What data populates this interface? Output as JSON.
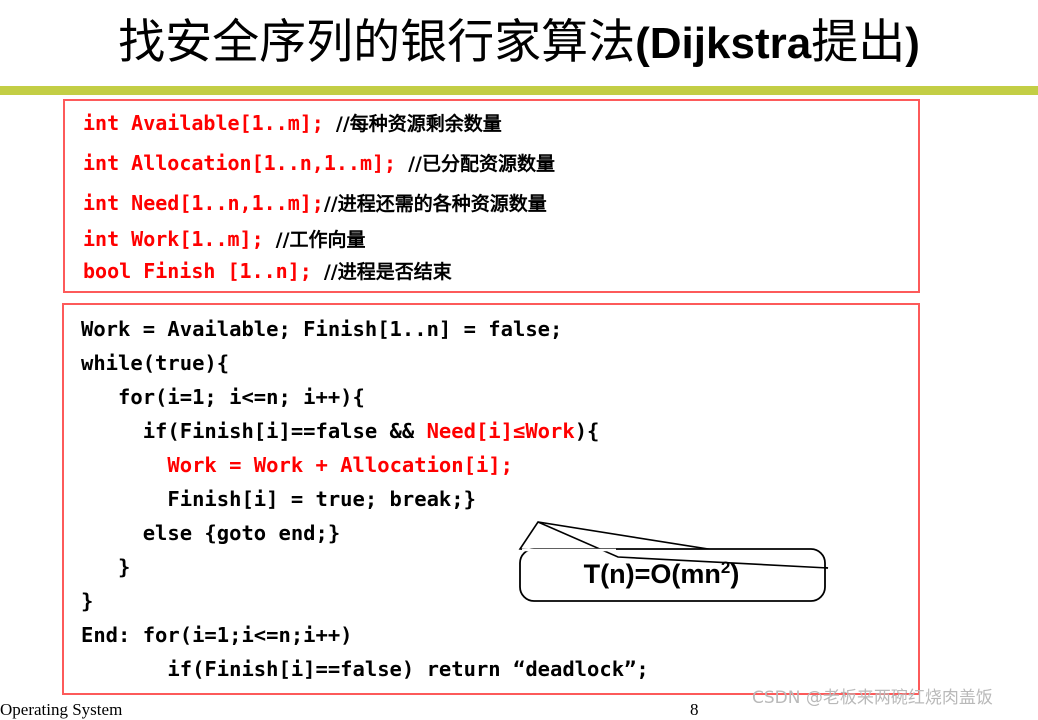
{
  "slide": {
    "title_cn_before": "找安全序列的银行家算法",
    "title_paren_open": "(",
    "title_latin": "Dijkstra",
    "title_cn_after": "提出",
    "title_paren_close": ")",
    "divider_color": "#c3ce45",
    "code_accent_color": "#ff0000",
    "box_border_color": "#fd5a5a"
  },
  "declaration_box": {
    "lines": [
      {
        "code": "int Available[1..m]; ",
        "comment": "//每种资源剩余数量"
      },
      {
        "code": "int Allocation[1..n,1..m]; ",
        "comment": "//已分配资源数量"
      },
      {
        "code": "int Need[1..n,1..m];",
        "comment": "//进程还需的各种资源数量"
      },
      {
        "code": "int Work[1..m]; ",
        "comment": "//工作向量"
      },
      {
        "code": "bool Finish [1..n]; ",
        "comment": "//进程是否结束"
      }
    ]
  },
  "algorithm_box": {
    "lines": [
      {
        "black_before": "Work = Available; Finish[1..n] = false;",
        "red": "",
        "black_after": ""
      },
      {
        "black_before": "while(true){",
        "red": "",
        "black_after": ""
      },
      {
        "black_before": "   for(i=1; i<=n; i++){",
        "red": "",
        "black_after": ""
      },
      {
        "black_before": "     if(Finish[i]==false && ",
        "red": "Need[i]≤Work",
        "black_after": "){"
      },
      {
        "black_before": "       ",
        "red": "Work = Work + Allocation[i];",
        "black_after": ""
      },
      {
        "black_before": "       Finish[i] = true; break;}",
        "red": "",
        "black_after": ""
      },
      {
        "black_before": "     else {goto end;}",
        "red": "",
        "black_after": ""
      },
      {
        "black_before": "   }",
        "red": "",
        "black_after": ""
      },
      {
        "black_before": "}",
        "red": "",
        "black_after": ""
      },
      {
        "black_before": "End: for(i=1;i<=n;i++)",
        "red": "",
        "black_after": ""
      },
      {
        "black_before": "       if(Finish[i]==false) return “deadlock”;",
        "red": "",
        "black_after": ""
      }
    ]
  },
  "callout": {
    "label_main": "T(n)=O(mn",
    "label_sup": "2",
    "label_tail": ")"
  },
  "watermark": {
    "text": "CSDN @老板来两碗红烧肉盖饭"
  },
  "footer": {
    "left": "Operating System",
    "page": "8"
  }
}
